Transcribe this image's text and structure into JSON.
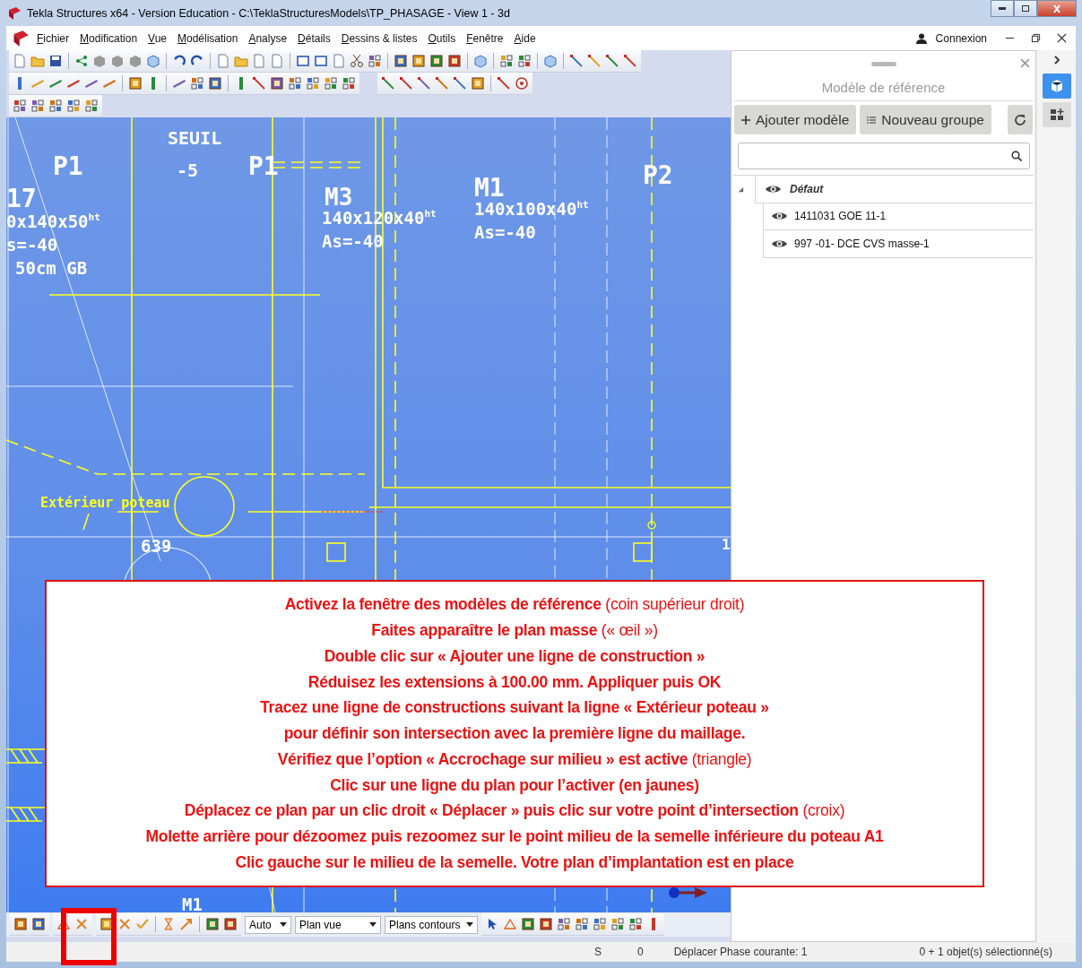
{
  "window": {
    "title": "Tekla Structures x64 - Version Education - C:\\TeklaStructuresModels\\TP_PHASAGE  - View 1 - 3d"
  },
  "menu": [
    "Fichier",
    "Modification",
    "Vue",
    "Modélisation",
    "Analyse",
    "Détails",
    "Dessins & listes",
    "Outils",
    "Fenêtre",
    "Aide"
  ],
  "account": {
    "label": "Connexion"
  },
  "viewport": {
    "labels": [
      {
        "text": "P1"
      },
      {
        "text": "SEUIL"
      },
      {
        "text": "-5"
      },
      {
        "text": "P1"
      },
      {
        "text": "M3"
      },
      {
        "text": "140x120x40$^{ht}$"
      },
      {
        "text": "As=-40"
      },
      {
        "text": "M1"
      },
      {
        "text": "140x100x40$^{ht}$"
      },
      {
        "text": "As=-40"
      },
      {
        "text": "P2"
      },
      {
        "text": "17"
      },
      {
        "text": "0x140x50$^{ht}$"
      },
      {
        "text": "s=-40"
      },
      {
        "text": "50cm GB"
      },
      {
        "text": "Extérieur poteau"
      },
      {
        "text": "639"
      },
      {
        "text": "1"
      },
      {
        "text": "M1"
      }
    ]
  },
  "instructions": [
    {
      "text": "Activez la fenêtre des modèles de référence",
      "note": "(coin supérieur droit)"
    },
    {
      "text": "Faites apparaître le plan masse",
      "note": "(« œil »)"
    },
    {
      "text": "Double clic sur « Ajouter une ligne de construction »"
    },
    {
      "text": "Réduisez les extensions à 100.00 mm. Appliquer puis OK"
    },
    {
      "text": "Tracez une ligne de constructions suivant la ligne « Extérieur poteau »"
    },
    {
      "text": "pour définir son intersection avec la première ligne du maillage."
    },
    {
      "text": "Vérifiez que l’option « Accrochage sur milieu » est active",
      "note": "(triangle)"
    },
    {
      "text": "Clic sur une ligne du plan pour l’activer (en jaunes)"
    },
    {
      "text": "Déplacez ce plan par un clic droit « Déplacer » puis clic sur votre point d’intersection",
      "note": "(croix)"
    },
    {
      "text": "Molette arrière pour dézoomez puis rezoomez sur le point milieu de la semelle inférieure du poteau A1"
    },
    {
      "text": "Clic gauche sur le milieu de la semelle. Votre plan d’implantation est en place"
    }
  ],
  "bottom_toolbar": {
    "dropdowns": [
      {
        "value": "Auto"
      },
      {
        "value": "Plan vue"
      },
      {
        "value": "Plans contours"
      }
    ]
  },
  "reference_panel": {
    "title": "Modèle de référence",
    "buttons": [
      {
        "kind": "add",
        "label": "Ajouter modèle"
      },
      {
        "kind": "group",
        "label": "Nouveau groupe"
      }
    ],
    "tree": [
      {
        "label": "Défaut",
        "expanded": true,
        "children": [
          {
            "label": "1411031 GOE 11-1"
          },
          {
            "label": "997 -01- DCE CVS masse-1"
          }
        ]
      }
    ]
  },
  "side_tabs": [
    {
      "kind": "cube",
      "selected": true
    },
    {
      "kind": "grid",
      "selected": false
    }
  ],
  "status_bar": [
    "S",
    "0",
    "Déplacer Phase courante: 1",
    "0 + 1 objet(s) sélectionné(s)"
  ]
}
